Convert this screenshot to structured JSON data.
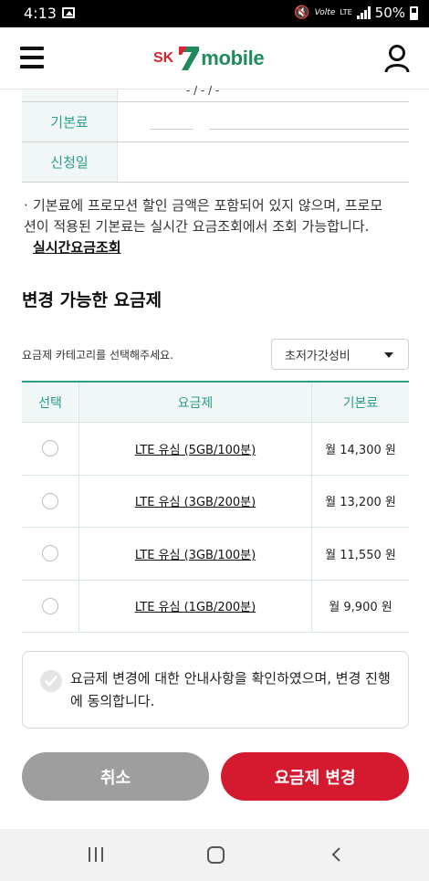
{
  "status": {
    "time": "4:13",
    "volte": "Volte",
    "lte": "LTE",
    "battery": "50%"
  },
  "header": {
    "logo_sk": "SK",
    "logo_mobile": "mobile"
  },
  "info_table": {
    "cut_text": "- / - / -",
    "rows": [
      {
        "label": "기본료"
      },
      {
        "label": "신청일"
      }
    ]
  },
  "notice": {
    "bullet": "·",
    "text": "기본료에 프로모션 할인 금액은 포함되어 있지 않으며, 프로모션이 적용된 기본료는 실시간 요금조회에서 조회 가능합니다.",
    "link": "실시간요금조회"
  },
  "section_title": "변경 가능한 요금제",
  "category": {
    "label": "요금제 카테고리를 선택해주세요.",
    "selected": "초저가갓성비"
  },
  "plan_table": {
    "headers": [
      "선택",
      "요금제",
      "기본료"
    ],
    "rows": [
      {
        "name": "LTE 유심 (5GB/100분)",
        "price": "월 14,300 원"
      },
      {
        "name": "LTE 유심 (3GB/200분)",
        "price": "월 13,200 원"
      },
      {
        "name": "LTE 유심 (3GB/100분)",
        "price": "월 11,550 원"
      },
      {
        "name": "LTE 유심 (1GB/200분)",
        "price": "월 9,900 원"
      }
    ]
  },
  "agreement": {
    "text": "요금제 변경에 대한 안내사항을 확인하였으며, 변경 진행에 동의합니다."
  },
  "buttons": {
    "cancel": "취소",
    "change": "요금제 변경"
  },
  "colors": {
    "accent": "#2a9d8f",
    "brand_red": "#d51a2f",
    "brand_green": "#1f8a5c"
  }
}
